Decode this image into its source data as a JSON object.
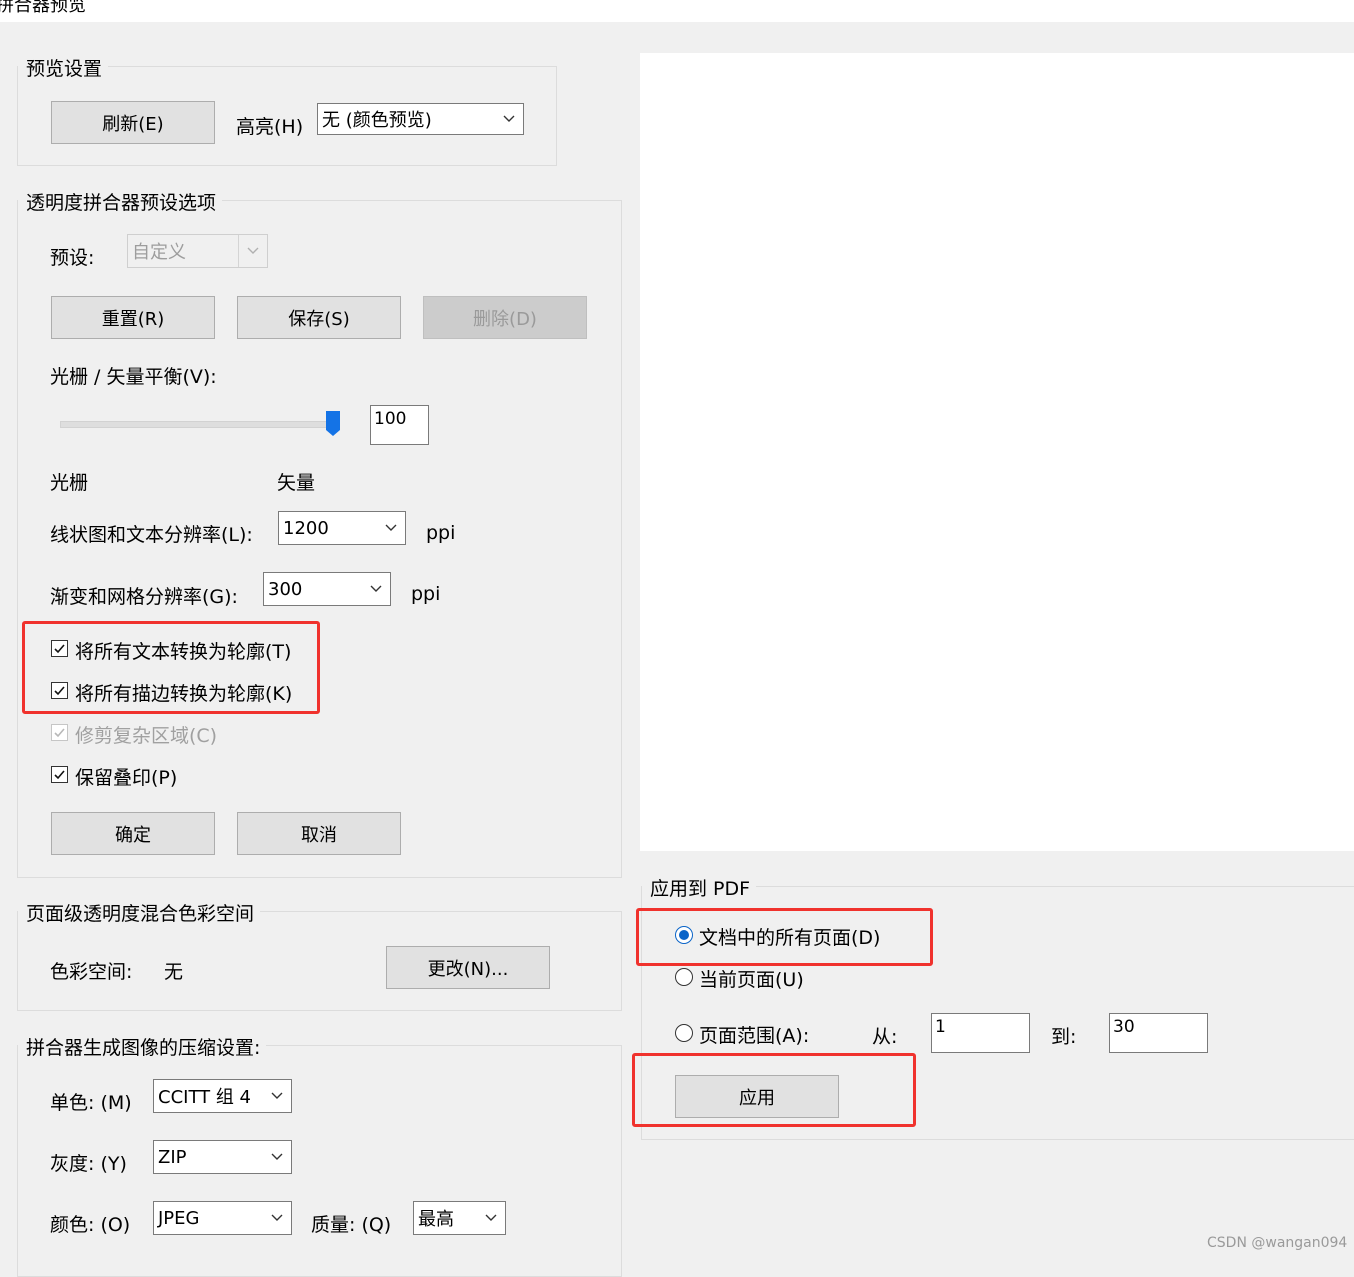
{
  "window": {
    "title": "拼合器预览"
  },
  "preview_settings": {
    "group_label": "预览设置",
    "refresh_button": "刷新(E)",
    "highlight_label": "高亮(H)",
    "highlight_value": "无 (颜色预览)"
  },
  "flattener_options": {
    "group_label": "透明度拼合器预设选项",
    "preset_label": "预设:",
    "preset_value": "自定义",
    "reset_button": "重置(R)",
    "save_button": "保存(S)",
    "delete_button": "删除(D)",
    "balance_label": "光栅 / 矢量平衡(V):",
    "balance_value": "100",
    "balance_level": 100,
    "raster_label": "光栅",
    "vector_label": "矢量",
    "lineart_label": "线状图和文本分辨率(L):",
    "lineart_value": "1200",
    "gradient_label": "渐变和网格分辨率(G):",
    "gradient_value": "300",
    "ppi_unit": "ppi",
    "checkboxes": [
      {
        "label": "将所有文本转换为轮廓(T)",
        "checked": true,
        "enabled": true
      },
      {
        "label": "将所有描边转换为轮廓(K)",
        "checked": true,
        "enabled": true
      },
      {
        "label": "修剪复杂区域(C)",
        "checked": true,
        "enabled": false
      },
      {
        "label": "保留叠印(P)",
        "checked": true,
        "enabled": true
      }
    ],
    "ok_button": "确定",
    "cancel_button": "取消"
  },
  "color_space": {
    "group_label": "页面级透明度混合色彩空间",
    "label": "色彩空间:",
    "value": "无",
    "change_button": "更改(N)..."
  },
  "compression": {
    "group_label": "拼合器生成图像的压缩设置:",
    "mono_label": "单色: (M)",
    "mono_value": "CCITT 组 4",
    "gray_label": "灰度: (Y)",
    "gray_value": "ZIP",
    "color_label": "颜色: (O)",
    "color_value": "JPEG",
    "quality_label": "质量: (Q)",
    "quality_value": "最高"
  },
  "apply_pdf": {
    "group_label": "应用到 PDF",
    "options": [
      {
        "label": "文档中的所有页面(D)",
        "selected": true
      },
      {
        "label": "当前页面(U)",
        "selected": false
      },
      {
        "label": "页面范围(A):",
        "selected": false
      }
    ],
    "from_label": "从:",
    "from_value": "1",
    "to_label": "到:",
    "to_value": "30",
    "apply_button": "应用"
  },
  "watermark": "CSDN @wangan094",
  "colors": {
    "highlight_box": "#f0322d",
    "accent": "#0a64c8"
  }
}
